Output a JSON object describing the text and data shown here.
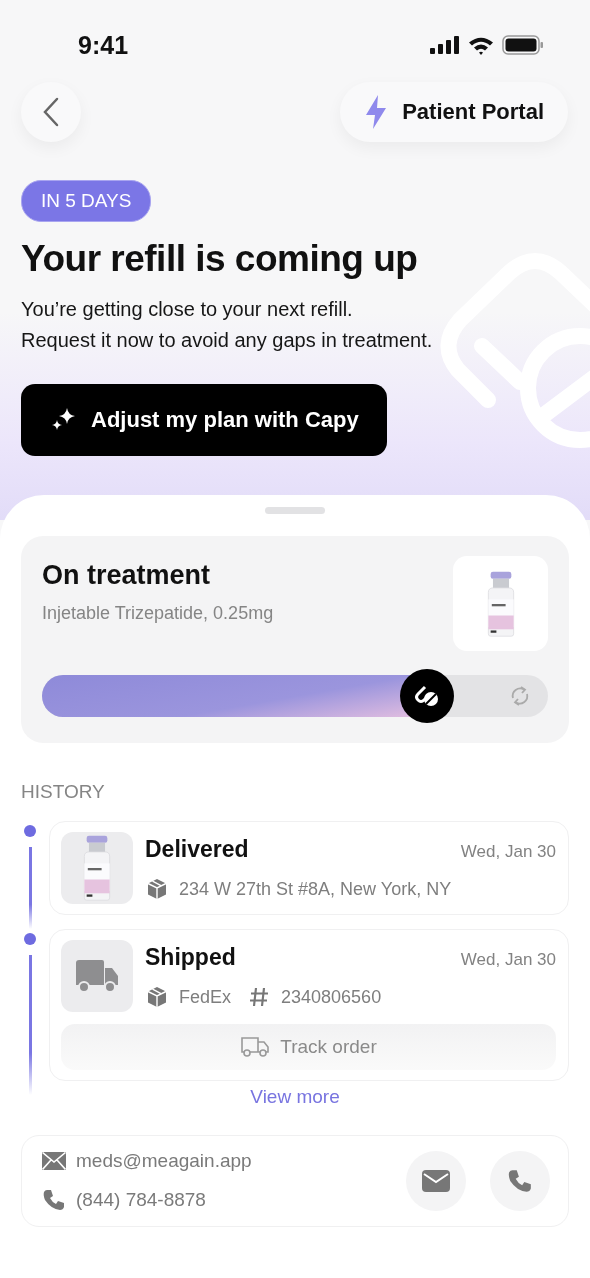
{
  "status_bar": {
    "time": "9:41"
  },
  "header": {
    "portal_label": "Patient Portal"
  },
  "hero": {
    "badge": "IN 5 DAYS",
    "title": "Your refill is coming up",
    "lines": [
      "You’re getting close to your next refill.",
      "Request it now to avoid any gaps in treatment."
    ],
    "button": "Adjust my plan with Capy"
  },
  "treatment": {
    "title": "On treatment",
    "subtitle": "Injetable Trizepatide, 0.25mg",
    "level": 0.76
  },
  "history": {
    "heading": "HISTORY",
    "items": [
      {
        "kind": "vial",
        "title": "Delivered",
        "date": "Wed, Jan 30",
        "details": [
          {
            "kind": "package",
            "text": "234 W 27th St #8A, New York, NY"
          }
        ]
      },
      {
        "kind": "truck",
        "title": "Shipped",
        "date": "Wed, Jan 30",
        "details": [
          {
            "kind": "package",
            "text": "FedEx"
          },
          {
            "kind": "number",
            "text": "2340806560"
          }
        ],
        "action": "Track order"
      }
    ],
    "view_more": "View more"
  },
  "contact": {
    "email": "meds@meagain.app",
    "phone": "(844) 784-8878"
  }
}
